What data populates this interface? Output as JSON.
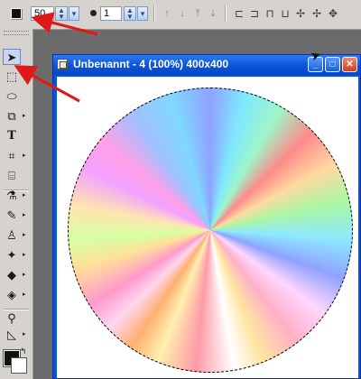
{
  "toolbar": {
    "size_value": "50",
    "opacity_value": "1",
    "icons": [
      "fg-color-icon",
      "up-icon",
      "down-icon",
      "top-icon",
      "bottom-icon",
      "distribute-icon",
      "align-icon",
      "group-icon",
      "split-icon",
      "move-icon"
    ]
  },
  "window": {
    "title": "Unbenannt - 4 (100%) 400x400",
    "minimize": "_",
    "maximize": "□",
    "close": "✕"
  },
  "tools": [
    {
      "name": "pointer-tool",
      "glyph": "➤"
    },
    {
      "name": "selection-tool",
      "glyph": "⬚"
    },
    {
      "name": "eraser-tool",
      "glyph": "⬭"
    },
    {
      "name": "clone-tool",
      "glyph": "⧉"
    },
    {
      "name": "text-tool",
      "glyph": "T"
    },
    {
      "name": "crop-tool",
      "glyph": "⌗"
    },
    {
      "name": "frame-tool",
      "glyph": "⌸"
    },
    {
      "name": "dropper-tool",
      "glyph": "⚗"
    },
    {
      "name": "brush-tool",
      "glyph": "✎"
    },
    {
      "name": "stamp-tool",
      "glyph": "♙"
    },
    {
      "name": "spray-tool",
      "glyph": "✦"
    },
    {
      "name": "fill-tool",
      "glyph": "◆"
    },
    {
      "name": "bucket-tool",
      "glyph": "◈"
    },
    {
      "name": "zoom-tool",
      "glyph": "⚲"
    },
    {
      "name": "line-tool",
      "glyph": "◺"
    }
  ],
  "colors": {
    "annotation_red": "#e01818",
    "title_blue": "#0a53d8"
  }
}
